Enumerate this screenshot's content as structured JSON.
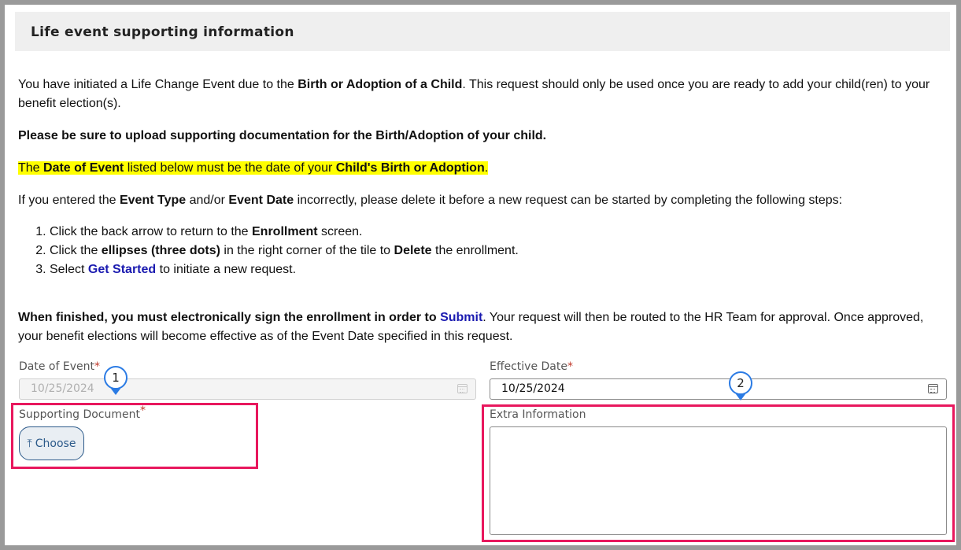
{
  "header": {
    "title": "Life event supporting information"
  },
  "intro": {
    "p1_a": "You have initiated a Life Change Event due to the ",
    "p1_b": "Birth or Adoption of a Child",
    "p1_c": ". This request should only be used once you are ready to add your child(ren) to your benefit election(s).",
    "p2": "Please be sure to upload supporting documentation for the Birth/Adoption of your child.",
    "p3_a": "The ",
    "p3_b": "Date of Event",
    "p3_c": " listed below must be the date of your ",
    "p3_d": "Child's Birth or Adoption",
    "p3_e": ".",
    "p4_a": "If you entered the ",
    "p4_b": "Event Type",
    "p4_c": " and/or ",
    "p4_d": "Event Date",
    "p4_e": " incorrectly, please delete it before a new request can be started by completing the following steps:"
  },
  "steps": [
    {
      "a": "Click the back arrow to return to the ",
      "b": "Enrollment",
      "c": " screen."
    },
    {
      "a": "Click the ",
      "b": "ellipses (three dots)",
      "c": " in the right corner of the tile to ",
      "d": "Delete",
      "e": " the enrollment."
    },
    {
      "a": "Select ",
      "b": "Get Started",
      "c": " to initiate a new request."
    }
  ],
  "finish": {
    "a": "When finished, you must electronically sign the enrollment in order to ",
    "b": "Submit",
    "c": ". Your request will then be routed to the HR Team for approval. Once approved, your benefit elections will become effective as of the Event Date specified in this request."
  },
  "form": {
    "date_of_event_label": "Date of Event",
    "date_of_event_value": "10/25/2024",
    "effective_date_label": "Effective Date",
    "effective_date_value": "10/25/2024",
    "supporting_document_label": "Supporting Document",
    "choose_label": "Choose",
    "extra_information_label": "Extra Information",
    "required_mark": "*"
  },
  "annotations": {
    "marker1": "1",
    "marker2": "2"
  },
  "colors": {
    "highlight": "#ffff00",
    "callout": "#e8175d",
    "marker": "#2b7be4",
    "link": "#1a1ab0"
  }
}
